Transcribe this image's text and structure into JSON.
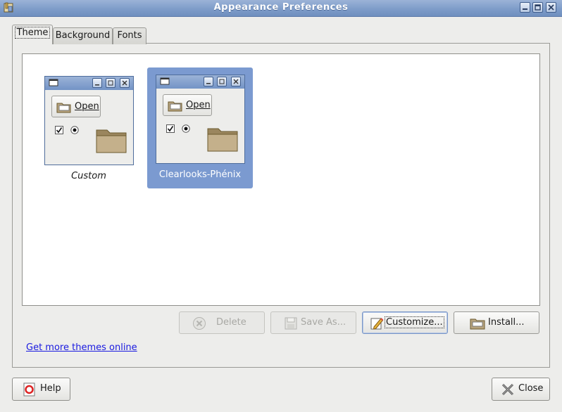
{
  "window": {
    "title": "Appearance Preferences"
  },
  "tabs": [
    {
      "label": "Theme",
      "active": true
    },
    {
      "label": "Background",
      "active": false
    },
    {
      "label": "Fonts",
      "active": false
    }
  ],
  "themes": [
    {
      "name": "Custom",
      "selected": false,
      "preview_button": "Open"
    },
    {
      "name": "Clearlooks-Phénix",
      "selected": true,
      "preview_button": "Open"
    }
  ],
  "actions": {
    "delete": {
      "label": "Delete",
      "enabled": false
    },
    "save_as": {
      "label": "Save As...",
      "enabled": false
    },
    "customize": {
      "label": "Customize...",
      "enabled": true
    },
    "install": {
      "label": "Install...",
      "enabled": true
    }
  },
  "more_themes_link": "Get more themes online",
  "footer": {
    "help": "Help",
    "close": "Close"
  },
  "colors": {
    "titlebar": "#7e9cc9",
    "selection": "#7b9ad0",
    "link": "#1a1ae0",
    "window_bg": "#ededeb"
  }
}
